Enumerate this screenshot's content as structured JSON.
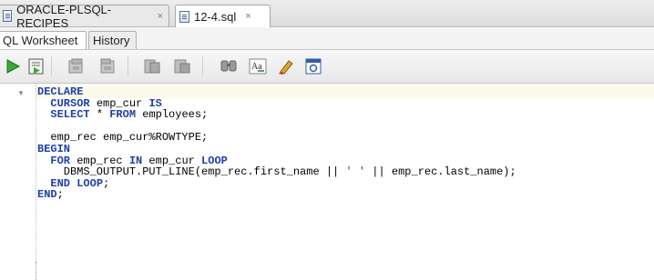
{
  "colors": {
    "keyword": "#1f3fa8",
    "string": "#1b6b1b",
    "current_line": "#fbfbe8"
  },
  "document_tabs": [
    {
      "label": "ORACLE-PLSQL-RECIPES",
      "icon": "connection-icon",
      "close": "×"
    },
    {
      "label": "12-4.sql",
      "icon": "sql-file-icon",
      "close": "×"
    }
  ],
  "subtabs": [
    {
      "label": "QL Worksheet"
    },
    {
      "label": "History"
    }
  ],
  "toolbar": [
    {
      "name": "run-statement-button",
      "icon": "play-icon"
    },
    {
      "name": "run-script-button",
      "icon": "script-icon"
    },
    {
      "name": "commit-button",
      "icon": "commit-icon"
    },
    {
      "name": "rollback-button",
      "icon": "rollback-icon"
    },
    {
      "name": "unshared-sql-button",
      "icon": "unshared-icon"
    },
    {
      "name": "cancel-button",
      "icon": "cancel-icon"
    },
    {
      "name": "sql-tuning-button",
      "icon": "tuning-icon"
    },
    {
      "name": "to-upper-lower-button",
      "icon": "case-icon"
    },
    {
      "name": "clear-button",
      "icon": "eraser-icon"
    },
    {
      "name": "autotrace-button",
      "icon": "autotrace-icon"
    }
  ],
  "editor": {
    "lines": [
      [
        {
          "t": "DECLARE",
          "k": "kw"
        }
      ],
      [
        {
          "t": "  "
        },
        {
          "t": "CURSOR",
          "k": "kw"
        },
        {
          "t": " emp_cur "
        },
        {
          "t": "IS",
          "k": "kw"
        }
      ],
      [
        {
          "t": "  "
        },
        {
          "t": "SELECT",
          "k": "kw"
        },
        {
          "t": " * "
        },
        {
          "t": "FROM",
          "k": "kw"
        },
        {
          "t": " employees;"
        }
      ],
      [
        {
          "t": ""
        }
      ],
      [
        {
          "t": "  emp_rec emp_cur%ROWTYPE;"
        }
      ],
      [
        {
          "t": "BEGIN",
          "k": "kw"
        }
      ],
      [
        {
          "t": "  "
        },
        {
          "t": "FOR",
          "k": "kw"
        },
        {
          "t": " emp_rec "
        },
        {
          "t": "IN",
          "k": "kw"
        },
        {
          "t": " emp_cur "
        },
        {
          "t": "LOOP",
          "k": "kw"
        }
      ],
      [
        {
          "t": "    DBMS_OUTPUT.PUT_LINE(emp_rec.first_name || "
        },
        {
          "t": "' '",
          "k": "str"
        },
        {
          "t": " || emp_rec.last_name);"
        }
      ],
      [
        {
          "t": "  "
        },
        {
          "t": "END LOOP",
          "k": "kw"
        },
        {
          "t": ";"
        }
      ],
      [
        {
          "t": "END",
          "k": "kw"
        },
        {
          "t": ";"
        }
      ]
    ]
  }
}
